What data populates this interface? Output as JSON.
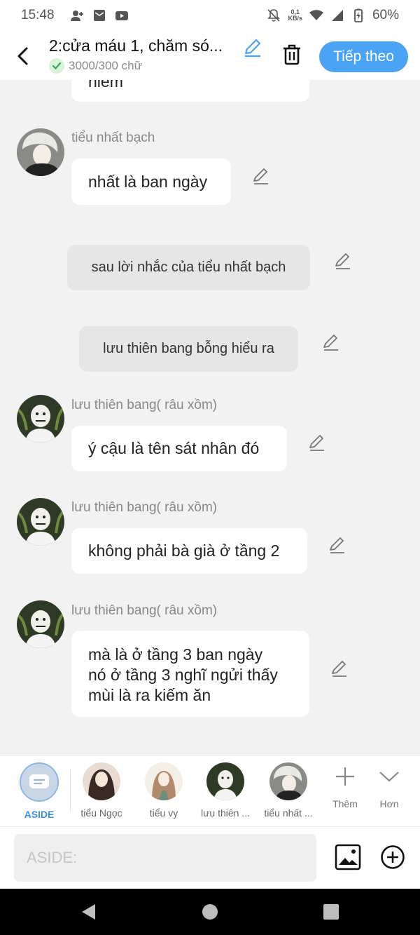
{
  "status_bar": {
    "time": "15:48",
    "net_speed_top": "0,1",
    "net_speed_unit": "KB/s",
    "battery": "60%"
  },
  "header": {
    "title": "2:cửa máu 1, chăm só...",
    "word_count": "3000/300 chữ",
    "next_label": "Tiếp theo"
  },
  "messages": {
    "top_partial": "hiểm",
    "m1_sender": "tiểu nhất bạch",
    "m1_text": "nhất là ban ngày",
    "n1_text": "sau lời nhắc của tiểu nhất bạch",
    "n2_text": "lưu thiên bang bỗng hiểu ra",
    "m2_sender": "lưu thiên bang( râu xồm)",
    "m2_text": "ý cậu là tên sát nhân đó",
    "m3_sender": "lưu thiên bang( râu xồm)",
    "m3_text": "không phải bà già ở tầng 2",
    "m4_sender": "lưu thiên bang( râu xồm)",
    "m4_line1": "mà là ở tầng 3 ban ngày",
    "m4_line2": "nó ở tầng 3 nghĩ ngửi thấy",
    "m4_line3": "mùi là ra kiếm ăn"
  },
  "char_bar": {
    "aside": "ASIDE",
    "c1": "tiểu Ngọc",
    "c2": "tiểu vy",
    "c3": "lưu thiên ...",
    "c4": "tiểu nhất ...",
    "more": "Thêm",
    "collapse": "Hơn"
  },
  "input": {
    "placeholder": "ASIDE:"
  },
  "colors": {
    "accent": "#4ba3f5",
    "bubble": "#ffffff",
    "narration": "#e6e6e6",
    "background": "#f2f2f2"
  }
}
